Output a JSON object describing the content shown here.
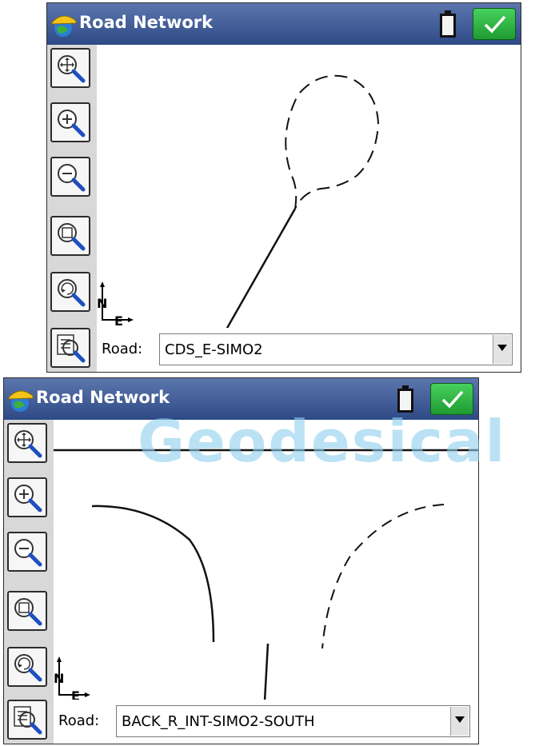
{
  "screens": [
    {
      "title": "Road Network",
      "road_label": "Road:",
      "road_value": "CDS_E-SIMO2"
    },
    {
      "title": "Road Network",
      "road_label": "Road:",
      "road_value": "BACK_R_INT-SIMO2-SOUTH"
    }
  ],
  "compass": {
    "north": "N",
    "east": "E"
  },
  "watermark": "Geodesical",
  "tools": [
    "zoom-extents-icon",
    "zoom-in-icon",
    "zoom-out-icon",
    "zoom-window-icon",
    "zoom-previous-icon",
    "road-options-icon"
  ],
  "colors": {
    "titlebar": "#2e4a86",
    "ok": "#2fbf45",
    "watermark": "#8fd0ee"
  }
}
